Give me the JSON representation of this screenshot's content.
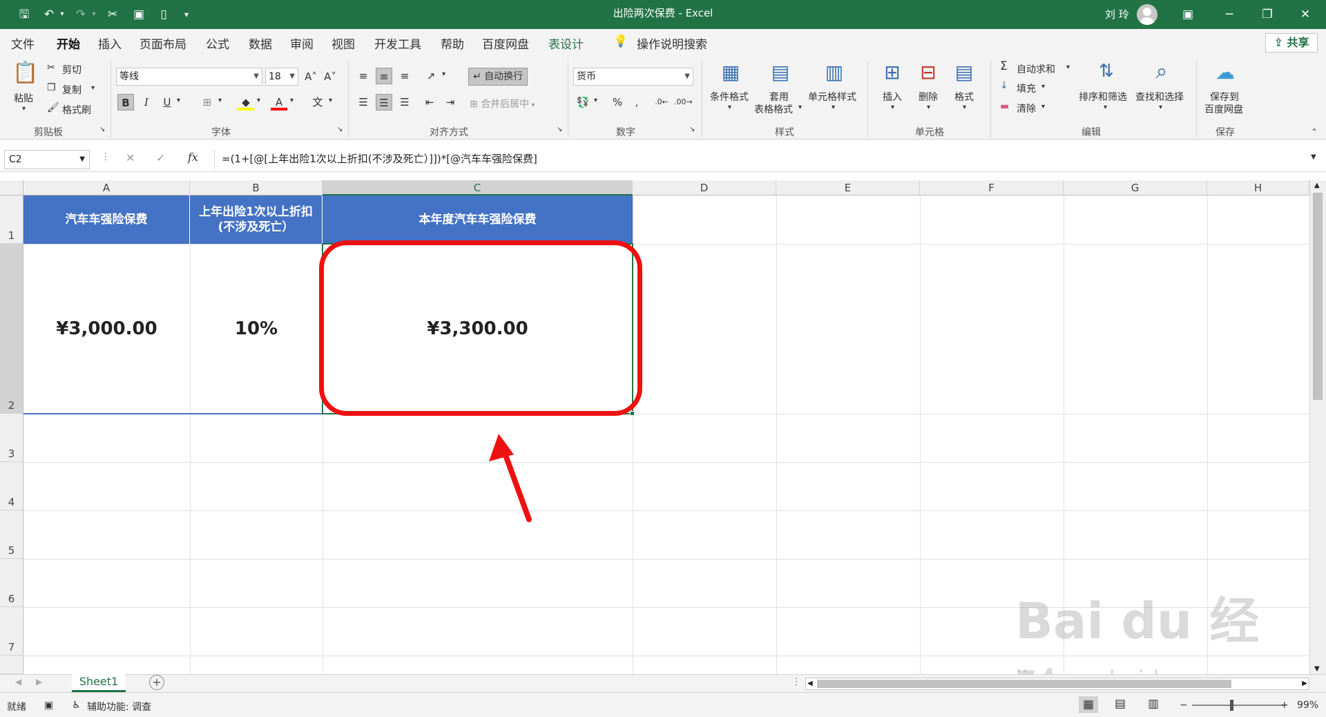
{
  "window": {
    "title": "出险两次保费 - Excel",
    "user": "刘 玲"
  },
  "ribbon_tabs": [
    "文件",
    "开始",
    "插入",
    "页面布局",
    "公式",
    "数据",
    "审阅",
    "视图",
    "开发工具",
    "帮助",
    "百度网盘",
    "表设计"
  ],
  "active_tab": "开始",
  "tell_me": "操作说明搜索",
  "share": "共享",
  "clipboard": {
    "paste": "粘贴",
    "cut": "剪切",
    "copy": "复制",
    "format_painter": "格式刷",
    "label": "剪贴板"
  },
  "font": {
    "name": "等线",
    "size": "18",
    "label": "字体",
    "bold": "B",
    "italic": "I",
    "underline": "U"
  },
  "alignment": {
    "wrap": "自动换行",
    "merge": "合并后居中",
    "label": "对齐方式"
  },
  "number": {
    "format": "货币",
    "percent": "%",
    "label": "数字"
  },
  "styles": {
    "conditional": "条件格式",
    "table_format_1": "套用",
    "table_format_2": "表格格式",
    "cell_styles": "单元格样式",
    "label": "样式"
  },
  "cells": {
    "insert": "插入",
    "delete": "删除",
    "format": "格式",
    "label": "单元格"
  },
  "editing": {
    "autosum": "自动求和",
    "fill": "填充",
    "clear": "清除",
    "sort_filter": "排序和筛选",
    "find_select": "查找和选择",
    "label": "编辑"
  },
  "save_group": {
    "btn_1": "保存到",
    "btn_2": "百度网盘",
    "label": "保存"
  },
  "formula_bar": {
    "cell_ref": "C2",
    "formula": "=(1+[@[上年出险1次以上折扣(不涉及死亡）]])*[@汽车车强险保费]"
  },
  "columns": [
    "A",
    "B",
    "C",
    "D",
    "E",
    "F",
    "G",
    "H"
  ],
  "rows": [
    "1",
    "2",
    "3",
    "4",
    "5",
    "6",
    "7"
  ],
  "table": {
    "headers": [
      "汽车车强险保费",
      "上年出险1次以上折扣",
      "(不涉及死亡）",
      "本年度汽车车强险保费"
    ],
    "values": [
      "¥3,000.00",
      "10%",
      "¥3,300.00"
    ]
  },
  "sheet_tab": "Sheet1",
  "status": {
    "ready": "就绪",
    "accessibility": "辅助功能: 调查",
    "zoom": "99%"
  },
  "watermark": {
    "text": "Bai du 经验",
    "url": "jingyan.baidu.com"
  }
}
